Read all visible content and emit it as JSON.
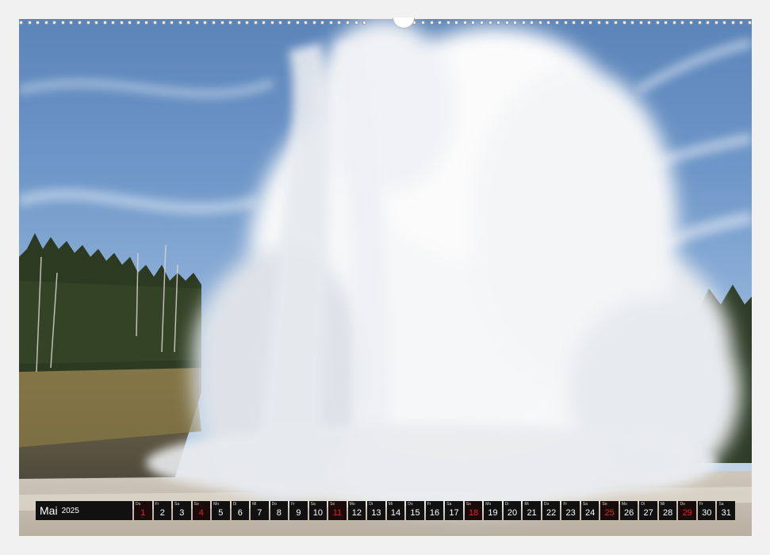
{
  "calendar": {
    "month": "Mai",
    "year": "2025",
    "holiday_color": "#e02424",
    "days": [
      {
        "wd": "Do",
        "num": "1",
        "red": true
      },
      {
        "wd": "Fr",
        "num": "2",
        "red": false
      },
      {
        "wd": "Sa",
        "num": "3",
        "red": false
      },
      {
        "wd": "So",
        "num": "4",
        "red": true
      },
      {
        "wd": "Mo",
        "num": "5",
        "red": false
      },
      {
        "wd": "Di",
        "num": "6",
        "red": false
      },
      {
        "wd": "Mi",
        "num": "7",
        "red": false
      },
      {
        "wd": "Do",
        "num": "8",
        "red": false
      },
      {
        "wd": "Fr",
        "num": "9",
        "red": false
      },
      {
        "wd": "Sa",
        "num": "10",
        "red": false
      },
      {
        "wd": "So",
        "num": "11",
        "red": true
      },
      {
        "wd": "Mo",
        "num": "12",
        "red": false
      },
      {
        "wd": "Di",
        "num": "13",
        "red": false
      },
      {
        "wd": "Mi",
        "num": "14",
        "red": false
      },
      {
        "wd": "Do",
        "num": "15",
        "red": false
      },
      {
        "wd": "Fr",
        "num": "16",
        "red": false
      },
      {
        "wd": "Sa",
        "num": "17",
        "red": false
      },
      {
        "wd": "So",
        "num": "18",
        "red": true
      },
      {
        "wd": "Mo",
        "num": "19",
        "red": false
      },
      {
        "wd": "Di",
        "num": "20",
        "red": false
      },
      {
        "wd": "Mi",
        "num": "21",
        "red": false
      },
      {
        "wd": "Do",
        "num": "22",
        "red": false
      },
      {
        "wd": "Fr",
        "num": "23",
        "red": false
      },
      {
        "wd": "Sa",
        "num": "24",
        "red": false
      },
      {
        "wd": "So",
        "num": "25",
        "red": true
      },
      {
        "wd": "Mo",
        "num": "26",
        "red": false
      },
      {
        "wd": "Di",
        "num": "27",
        "red": false
      },
      {
        "wd": "Mi",
        "num": "28",
        "red": false
      },
      {
        "wd": "Do",
        "num": "29",
        "red": true
      },
      {
        "wd": "Fr",
        "num": "30",
        "red": false
      },
      {
        "wd": "Sa",
        "num": "31",
        "red": false
      }
    ]
  }
}
